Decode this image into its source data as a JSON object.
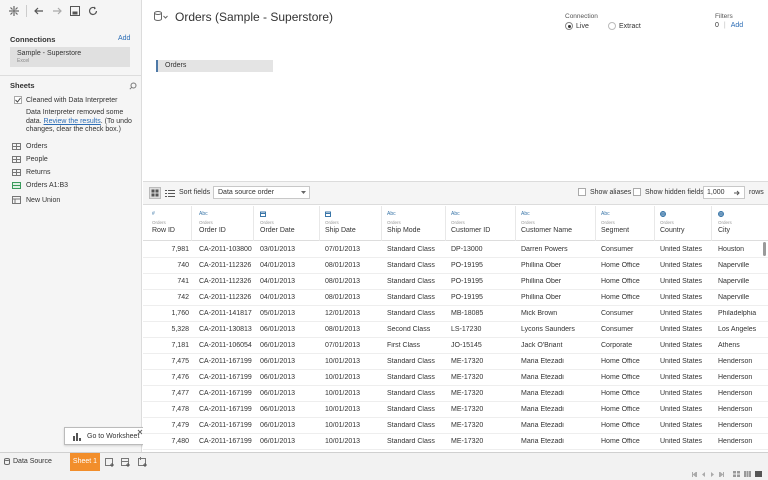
{
  "toolbar": {
    "icons": [
      "tableau-logo-icon",
      "back-icon",
      "forward-icon",
      "save-icon",
      "refresh-icon"
    ]
  },
  "sidebar": {
    "connections_title": "Connections",
    "add_label": "Add",
    "connection_name": "Sample - Superstore",
    "connection_type": "Excel",
    "sheets_title": "Sheets",
    "interpreter_label": "Cleaned with Data Interpreter",
    "interpreter_note_1": "Data Interpreter removed some",
    "interpreter_note_2": "data.",
    "interpreter_link": "Review the results",
    "interpreter_note_3": ". (To undo",
    "interpreter_note_4": "changes, clear the check box.)",
    "sheets": [
      "Orders",
      "People",
      "Returns",
      "Orders A1:B3"
    ],
    "new_union": "New Union"
  },
  "canvas": {
    "title": "Orders (Sample - Superstore)",
    "connection_label": "Connection",
    "live_label": "Live",
    "extract_label": "Extract",
    "filters_label": "Filters",
    "filters_count": "0",
    "filters_add": "Add",
    "table_pill": "Orders"
  },
  "grid_toolbar": {
    "sort_label": "Sort fields",
    "sort_value": "Data source order",
    "show_aliases": "Show aliases",
    "show_hidden": "Show hidden fields",
    "rows_value": "1,000",
    "rows_label": "rows"
  },
  "grid": {
    "columns": [
      {
        "type": "#",
        "source": "Orders",
        "name": "Row ID"
      },
      {
        "type": "Abc",
        "source": "Orders",
        "name": "Order ID"
      },
      {
        "type": "date-icon",
        "source": "Orders",
        "name": "Order Date"
      },
      {
        "type": "date-icon",
        "source": "Orders",
        "name": "Ship Date"
      },
      {
        "type": "Abc",
        "source": "Orders",
        "name": "Ship Mode"
      },
      {
        "type": "Abc",
        "source": "Orders",
        "name": "Customer ID"
      },
      {
        "type": "Abc",
        "source": "Orders",
        "name": "Customer Name"
      },
      {
        "type": "Abc",
        "source": "Orders",
        "name": "Segment"
      },
      {
        "type": "globe-icon",
        "source": "Orders",
        "name": "Country"
      },
      {
        "type": "globe-icon",
        "source": "Orders",
        "name": "City"
      }
    ],
    "rows": [
      [
        "7,981",
        "CA-2011-103800",
        "03/01/2013",
        "07/01/2013",
        "Standard Class",
        "DP-13000",
        "Darren Powers",
        "Consumer",
        "United States",
        "Houston"
      ],
      [
        "740",
        "CA-2011-112326",
        "04/01/2013",
        "08/01/2013",
        "Standard Class",
        "PO-19195",
        "Phillina Ober",
        "Home Office",
        "United States",
        "Naperville"
      ],
      [
        "741",
        "CA-2011-112326",
        "04/01/2013",
        "08/01/2013",
        "Standard Class",
        "PO-19195",
        "Phillina Ober",
        "Home Office",
        "United States",
        "Naperville"
      ],
      [
        "742",
        "CA-2011-112326",
        "04/01/2013",
        "08/01/2013",
        "Standard Class",
        "PO-19195",
        "Phillina Ober",
        "Home Office",
        "United States",
        "Naperville"
      ],
      [
        "1,760",
        "CA-2011-141817",
        "05/01/2013",
        "12/01/2013",
        "Standard Class",
        "MB-18085",
        "Mick Brown",
        "Consumer",
        "United States",
        "Philadelphia"
      ],
      [
        "5,328",
        "CA-2011-130813",
        "06/01/2013",
        "08/01/2013",
        "Second Class",
        "LS-17230",
        "Lycoris Saunders",
        "Consumer",
        "United States",
        "Los Angeles"
      ],
      [
        "7,181",
        "CA-2011-106054",
        "06/01/2013",
        "07/01/2013",
        "First Class",
        "JO-15145",
        "Jack O'Briant",
        "Corporate",
        "United States",
        "Athens"
      ],
      [
        "7,475",
        "CA-2011-167199",
        "06/01/2013",
        "10/01/2013",
        "Standard Class",
        "ME-17320",
        "Maria Etezadi",
        "Home Office",
        "United States",
        "Henderson"
      ],
      [
        "7,476",
        "CA-2011-167199",
        "06/01/2013",
        "10/01/2013",
        "Standard Class",
        "ME-17320",
        "Maria Etezadi",
        "Home Office",
        "United States",
        "Henderson"
      ],
      [
        "7,477",
        "CA-2011-167199",
        "06/01/2013",
        "10/01/2013",
        "Standard Class",
        "ME-17320",
        "Maria Etezadi",
        "Home Office",
        "United States",
        "Henderson"
      ],
      [
        "7,478",
        "CA-2011-167199",
        "06/01/2013",
        "10/01/2013",
        "Standard Class",
        "ME-17320",
        "Maria Etezadi",
        "Home Office",
        "United States",
        "Henderson"
      ],
      [
        "7,479",
        "CA-2011-167199",
        "06/01/2013",
        "10/01/2013",
        "Standard Class",
        "ME-17320",
        "Maria Etezadi",
        "Home Office",
        "United States",
        "Henderson"
      ],
      [
        "7,480",
        "CA-2011-167199",
        "06/01/2013",
        "10/01/2013",
        "Standard Class",
        "ME-17320",
        "Maria Etezadi",
        "Home Office",
        "United States",
        "Henderson"
      ]
    ]
  },
  "tooltip": {
    "label": "Go to Worksheet"
  },
  "bottom": {
    "data_source_tab": "Data Source",
    "sheet_tab": "Sheet 1",
    "accent_color": "#f28e2b"
  }
}
